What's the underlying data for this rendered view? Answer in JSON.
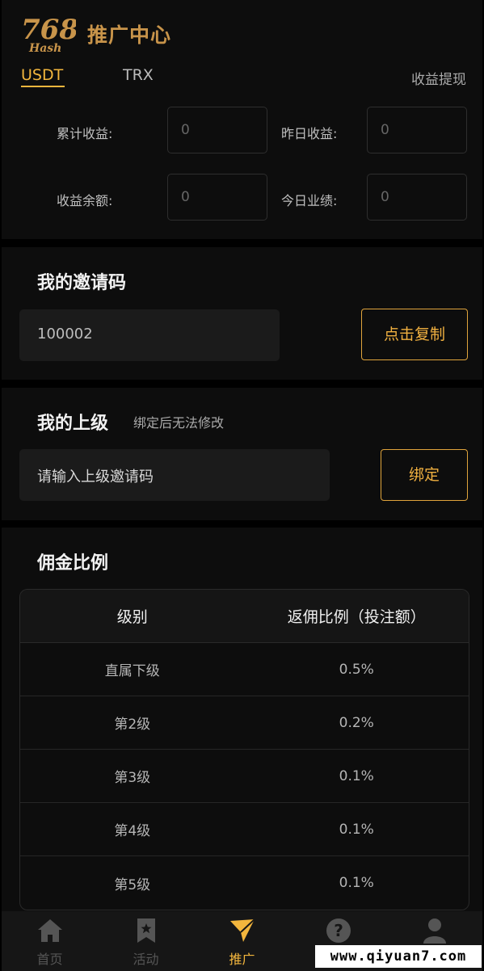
{
  "header": {
    "logo_text": "768",
    "logo_sub": "Hash",
    "title": "推广中心"
  },
  "tabs": [
    {
      "label": "USDT",
      "active": true
    },
    {
      "label": "TRX",
      "active": false
    }
  ],
  "withdraw_label": "收益提现",
  "stats": {
    "total_label": "累计收益:",
    "total_value": "0",
    "yesterday_label": "昨日收益:",
    "yesterday_value": "0",
    "balance_label": "收益余额:",
    "balance_value": "0",
    "today_label": "今日业绩:",
    "today_value": "0"
  },
  "invite": {
    "title": "我的邀请码",
    "code": "100002",
    "copy_label": "点击复制"
  },
  "parent": {
    "title": "我的上级",
    "note": "绑定后无法修改",
    "placeholder": "请输入上级邀请码",
    "bind_label": "绑定"
  },
  "commission": {
    "title": "佣金比例",
    "headers": [
      "级别",
      "返佣比例（投注额）"
    ],
    "rows": [
      [
        "直属下级",
        "0.5%"
      ],
      [
        "第2级",
        "0.2%"
      ],
      [
        "第3级",
        "0.1%"
      ],
      [
        "第4级",
        "0.1%"
      ],
      [
        "第5级",
        "0.1%"
      ]
    ]
  },
  "nav": [
    {
      "label": "首页",
      "icon": "home-icon",
      "active": false
    },
    {
      "label": "活动",
      "icon": "bookmark-star-icon",
      "active": false
    },
    {
      "label": "推广",
      "icon": "paper-plane-icon",
      "active": true
    },
    {
      "label": "",
      "icon": "help-icon",
      "active": false
    },
    {
      "label": "",
      "icon": "user-icon",
      "active": false
    }
  ],
  "watermark": "www.qiyuan7.com",
  "colors": {
    "accent": "#f3b63d",
    "brand": "#c8944a",
    "background": "#0d0d0d"
  }
}
